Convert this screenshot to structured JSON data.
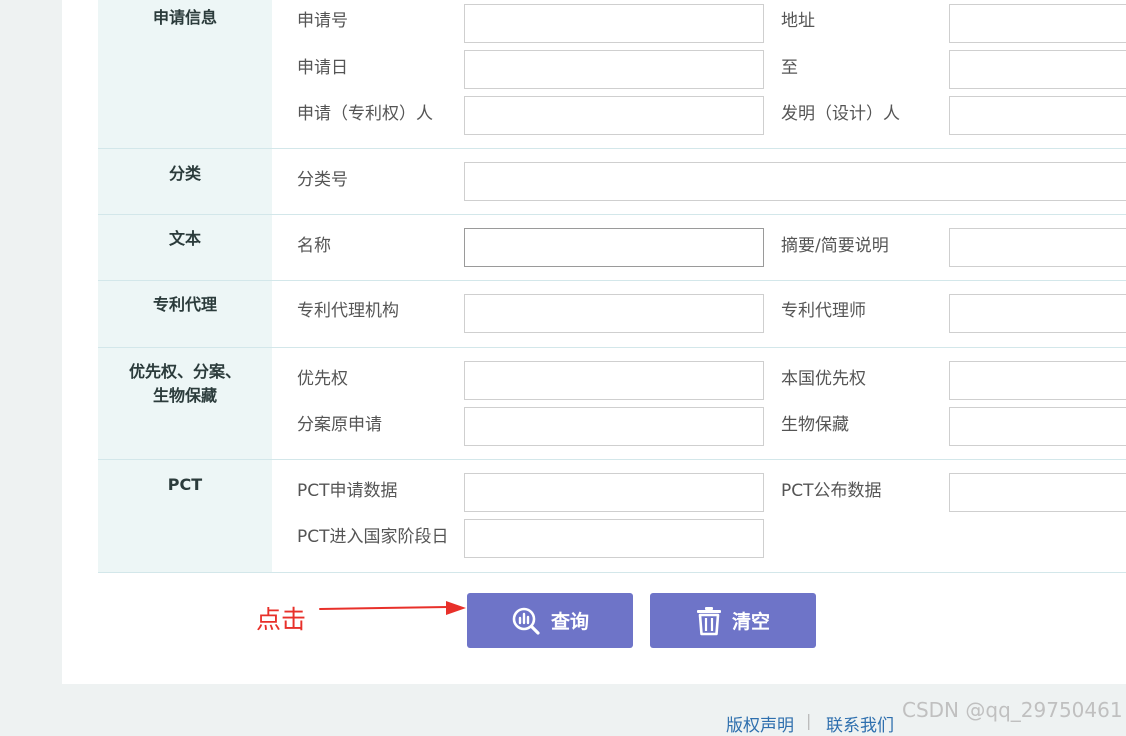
{
  "sections": [
    {
      "title": "申请信息",
      "fields": [
        {
          "label": "申请号",
          "value": ""
        },
        {
          "label": "地址",
          "value": ""
        },
        {
          "label": "申请日",
          "value": ""
        },
        {
          "label": "至",
          "value": ""
        },
        {
          "label": "申请（专利权）人",
          "value": ""
        },
        {
          "label": "发明（设计）人",
          "value": ""
        }
      ]
    },
    {
      "title": "分类",
      "fields": [
        {
          "label": "分类号",
          "value": ""
        }
      ]
    },
    {
      "title": "文本",
      "fields": [
        {
          "label": "名称",
          "value": ""
        },
        {
          "label": "摘要/简要说明",
          "value": ""
        }
      ]
    },
    {
      "title": "专利代理",
      "fields": [
        {
          "label": "专利代理机构",
          "value": ""
        },
        {
          "label": "专利代理师",
          "value": ""
        }
      ]
    },
    {
      "title": "优先权、分案、生物保藏",
      "title_lines": [
        "优先权、分案、",
        "生物保藏"
      ],
      "fields": [
        {
          "label": "优先权",
          "value": ""
        },
        {
          "label": "本国优先权",
          "value": ""
        },
        {
          "label": "分案原申请",
          "value": ""
        },
        {
          "label": "生物保藏",
          "value": ""
        }
      ]
    },
    {
      "title": "PCT",
      "fields": [
        {
          "label": "PCT申请数据",
          "value": ""
        },
        {
          "label": "PCT公布数据",
          "value": ""
        },
        {
          "label": "PCT进入国家阶段日",
          "value": ""
        }
      ]
    }
  ],
  "buttons": {
    "query": "查询",
    "clear": "清空"
  },
  "annotation": "点击",
  "footer": {
    "links": [
      "版权声明",
      "联系我们"
    ],
    "separator": "|"
  },
  "watermark": "CSDN @qq_29750461",
  "colors": {
    "button": "#6e74c8",
    "section_head_bg": "#edf6f6",
    "annotation": "#e8302a",
    "link": "#2e6fae"
  }
}
